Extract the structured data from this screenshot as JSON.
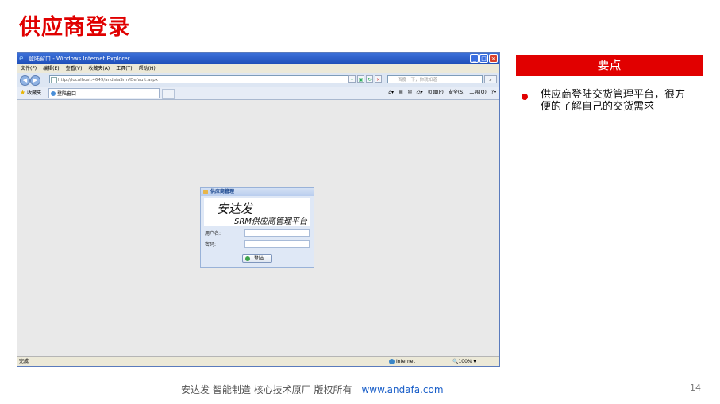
{
  "slide": {
    "title": "供应商登录",
    "key_points_header": "要点",
    "key_point": "供应商登陆交货管理平台，很方便的了解自己的交货需求",
    "footer_text": "安达发   智能制造 核心技术原厂    版权所有",
    "footer_link": "www.andafa.com",
    "page_number": "14"
  },
  "browser": {
    "title": "登陆窗口 - Windows Internet Explorer",
    "menu": [
      "文件(F)",
      "编辑(E)",
      "查看(V)",
      "收藏夹(A)",
      "工具(T)",
      "帮助(H)"
    ],
    "address": "http://localhost:4649/andafaSrm/Default.aspx",
    "search_placeholder": "百度一下，你就知道",
    "favorites_label": "收藏夹",
    "tab_title": "登陆窗口",
    "command_bar": [
      "页面(P)",
      "安全(S)",
      "工具(O)"
    ],
    "status_done": "完成",
    "status_zone": "Internet",
    "zoom": "100%"
  },
  "login": {
    "panel_title": "供应商管理",
    "brand": "安达发",
    "subtitle": "SRM供应商管理平台",
    "username_label": "用户名:",
    "password_label": "密码:",
    "button_label": "登陆"
  }
}
